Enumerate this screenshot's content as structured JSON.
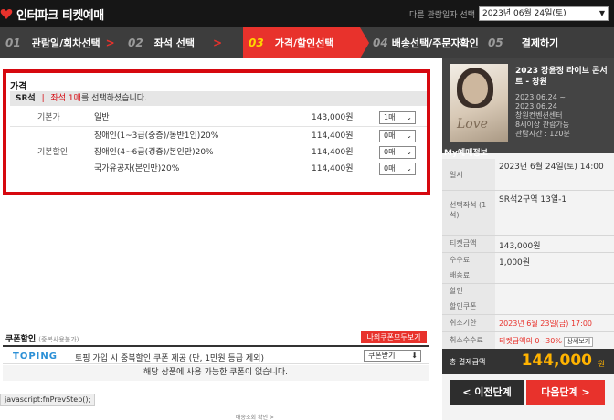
{
  "header": {
    "brand": "인터파크 티켓예매",
    "date_label": "다른 관람일자 선택",
    "date_value": "2023년 06월 24일(토)"
  },
  "steps": [
    {
      "num": "01",
      "label": "관람일/회차선택",
      "sep": ">"
    },
    {
      "num": "02",
      "label": "좌석 선택",
      "sep": ">"
    },
    {
      "num": "03",
      "label": "가격/할인선택",
      "sep": ""
    },
    {
      "num": "04",
      "label": "배송선택/주문자확인",
      "sep": ""
    },
    {
      "num": "05",
      "label": "결제하기",
      "sep": ""
    }
  ],
  "price": {
    "title": "가격",
    "seat_grade": "SR석",
    "seat_notice_red": "좌석 1매",
    "seat_notice_rest": "를 선택하셨습니다.",
    "rows": [
      {
        "cat": "기본가",
        "name": "일반",
        "price": "143,000원",
        "qty": "1매"
      },
      {
        "cat": "",
        "name": "장애인(1~3급(중증)/동반1인)20%",
        "price": "114,400원",
        "qty": "0매"
      },
      {
        "cat": "기본할인",
        "name": "장애인(4~6급(경증)/본인만)20%",
        "price": "114,400원",
        "qty": "0매"
      },
      {
        "cat": "",
        "name": "국가유공자(본인만)20%",
        "price": "114,400원",
        "qty": "0매"
      }
    ]
  },
  "coupon": {
    "title": "쿠폰할인",
    "subtitle": "(중복사용불가)",
    "my_coupon_button": "나의쿠폰모두보기",
    "toping": "TOPING",
    "desc": "토핑 가입 시 중복할인 쿠폰 제공 (단, 1만원 등급 제외)",
    "get_button": "쿠폰받기",
    "empty": "해당 상품에 사용 가능한 쿠폰이 없습니다."
  },
  "status_bar": "javascript:fnPrevStep();",
  "footer": "배송조회 확인 >",
  "show": {
    "title": "2023 장윤정 라이브 콘서트 - 창원",
    "period_start": "2023.06.24 ~",
    "period_end": "2023.06.24",
    "venue": "창원컨벤션센터",
    "age": "8세이상 관람가능",
    "runtime": "관람시간 : 120분",
    "poster_text": "Love"
  },
  "my_info": {
    "title": "My예매정보",
    "date_key": "일시",
    "date_value": "2023년 6월 24일(토) 14:00",
    "seat_key": "선택좌석 (1석)",
    "seat_value": "SR석2구역 13열-1",
    "ticket_key": "티켓금액",
    "ticket_value": "143,000원",
    "fee_key": "수수료",
    "fee_value": "1,000원",
    "ship_key": "배송료",
    "ship_value": "",
    "discount_key": "할인",
    "discount_value": "",
    "coupon_key": "할인쿠폰",
    "coupon_value": "",
    "cancel_key": "취소기한",
    "cancel_value": "2023년 6월 23일(금) 17:00",
    "cancel_fee_key": "취소수수료",
    "cancel_fee_value": "티켓금액의 0~30%",
    "detail_button": "상세보기",
    "total_key": "총 결제금액",
    "total_value": "144,000",
    "total_unit": "원"
  },
  "nav": {
    "prev": "< 이전단계",
    "next": "다음단계 >"
  }
}
